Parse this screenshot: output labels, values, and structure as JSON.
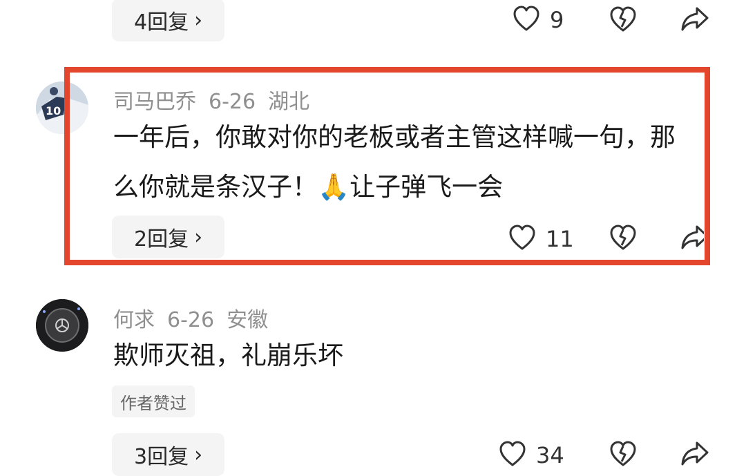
{
  "comments": [
    {
      "reply_label": "4回复",
      "like_count": "9"
    },
    {
      "username": "司马巴乔",
      "date": "6-26",
      "location": "湖北",
      "text": "一年后，你敢对你的老板或者主管这样喊一句，那么你就是条汉子！🙏让子弹飞一会",
      "reply_label": "2回复",
      "like_count": "11",
      "highlight_color": "#e3452d"
    },
    {
      "username": "何求",
      "date": "6-26",
      "location": "安徽",
      "text": "欺师灭祖，礼崩乐坏",
      "tag": "作者赞过",
      "reply_label": "3回复",
      "like_count": "34"
    }
  ],
  "icons": {
    "like": "heart-outline-icon",
    "dislike": "broken-heart-icon",
    "share": "share-arrow-icon",
    "chevron": "chevron-right-icon"
  }
}
